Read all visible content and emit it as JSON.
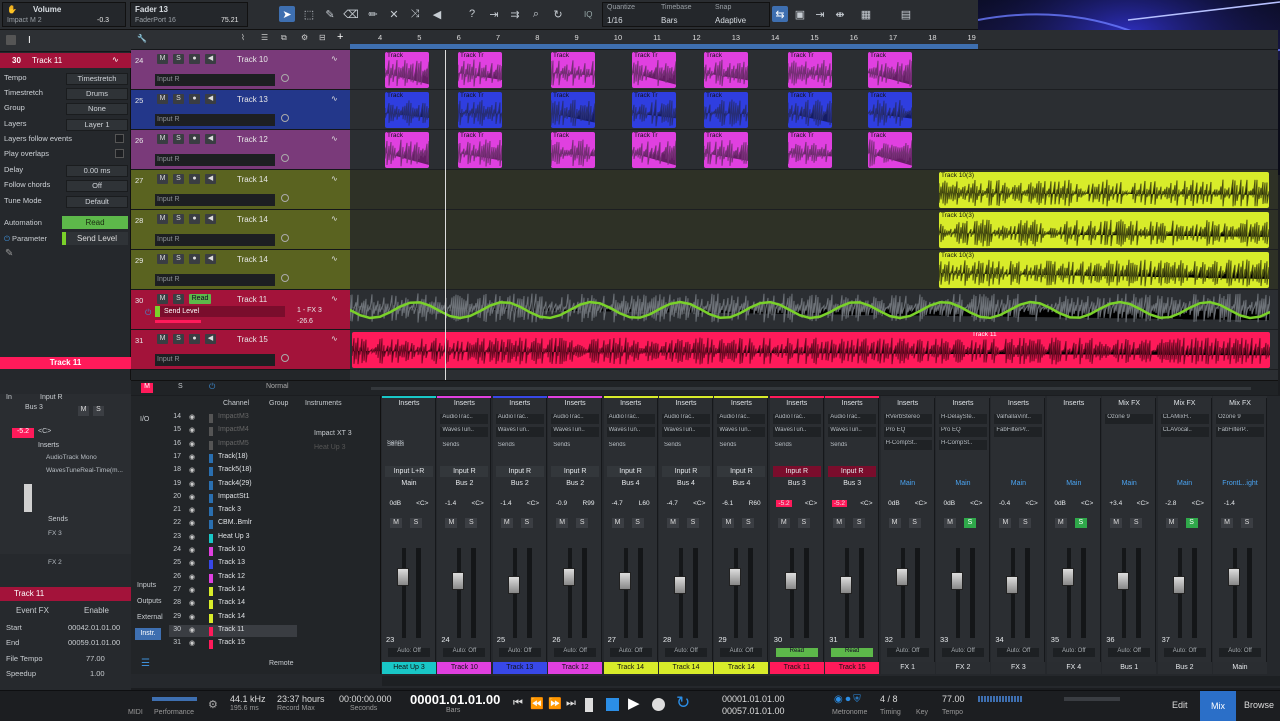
{
  "toolbar": {
    "plugin_title": "Volume",
    "plugin_sub": "Impact M 2",
    "plugin_value": "-0.3",
    "fader_title": "Fader 13",
    "fader_sub": "FaderPort 16",
    "fader_value": "75.21",
    "quantize_label": "Quantize",
    "quantize_value": "1/16",
    "timebase_label": "Timebase",
    "timebase_value": "Bars",
    "snap_label": "Snap",
    "snap_value": "Adaptive",
    "iq_label": "IQ"
  },
  "ruler": [
    "4",
    "5",
    "6",
    "7",
    "8",
    "9",
    "10",
    "11",
    "12",
    "13",
    "14",
    "15",
    "16",
    "17",
    "18",
    "19"
  ],
  "inspector": {
    "track_no": "30",
    "track_name": "Track 11",
    "rows": [
      {
        "label": "Tempo",
        "value": "Timestretch"
      },
      {
        "label": "Timestretch",
        "value": "Drums"
      },
      {
        "label": "Group",
        "value": "None"
      },
      {
        "label": "Layers",
        "value": "Layer 1"
      },
      {
        "label": "Layers follow events",
        "value": ""
      },
      {
        "label": "Play overlaps",
        "value": ""
      },
      {
        "label": "Delay",
        "value": "0.00 ms"
      },
      {
        "label": "Follow chords",
        "value": "Off"
      },
      {
        "label": "Tune Mode",
        "value": "Default"
      }
    ],
    "automation_label": "Automation",
    "automation_value": "Read",
    "parameter_label": "Parameter",
    "parameter_value": "Send Level",
    "track_banner": "Track 11",
    "in_label": "In",
    "in_value": "Input R",
    "bus_label": "Bus 3",
    "vol_value": "-5.2",
    "pan_value": "<C>",
    "inserts_label": "Inserts",
    "insert_1": "AudioTrack Mono",
    "insert_2": "WavesTuneReal-Time(m...",
    "sends_label": "Sends",
    "send_1": "FX 3",
    "send_2": "FX 2",
    "event_track": "Track 11",
    "event_fx": "Event FX",
    "enable": "Enable",
    "start_label": "Start",
    "start_value": "00042.01.01.00",
    "end_label": "End",
    "end_value": "00059.01.01.00",
    "filetempo_label": "File Tempo",
    "filetempo_value": "77.00",
    "speedup_label": "Speedup",
    "speedup_value": "1.00"
  },
  "tracks": [
    {
      "no": "24",
      "name": "Track 10",
      "input": "Input R",
      "color": "#7a3a7a",
      "clip": "#e040e0"
    },
    {
      "no": "25",
      "name": "Track 13",
      "input": "Input R",
      "color": "#23378a",
      "clip": "#2f3ee0"
    },
    {
      "no": "26",
      "name": "Track 12",
      "input": "Input R",
      "color": "#7a3a7a",
      "clip": "#e040e0"
    },
    {
      "no": "27",
      "name": "Track 14",
      "input": "Input R",
      "color": "#5a6320",
      "clip": "#d8ec2a"
    },
    {
      "no": "28",
      "name": "Track 14",
      "input": "Input R",
      "color": "#5a6320",
      "clip": "#d8ec2a"
    },
    {
      "no": "29",
      "name": "Track 14",
      "input": "Input R",
      "color": "#5a6320",
      "clip": "#d8ec2a"
    },
    {
      "no": "30",
      "name": "Track 11",
      "input": "Send Level",
      "color": "#a3133a",
      "clip": "#ff1a5a"
    },
    {
      "no": "31",
      "name": "Track 15",
      "input": "Input R",
      "color": "#a3133a",
      "clip": "#ff1a5a"
    }
  ],
  "track30": {
    "read": "Read",
    "send_dest": "1 - FX 3",
    "send_val": "-26.6"
  },
  "clip_labels": {
    "track": "Track",
    "track_tr": "Track Tr",
    "yellow": "Track 10(3)",
    "track11": "Track 11"
  },
  "arrfoot": {
    "m": "M",
    "s": "S",
    "mode": "Normal"
  },
  "console_nav": {
    "channel": "Channel",
    "group": "Group",
    "instruments": "Instruments",
    "inst_1": "Impact XT 2",
    "inst_2": "Impact XT 3",
    "inst_3": "Heat Up 3",
    "io": "I/O",
    "inputs": "Inputs",
    "outputs": "Outputs",
    "external": "External",
    "instr": "Instr.",
    "remote": "Remote"
  },
  "channel_list": [
    {
      "no": "14",
      "name": "ImpactM3"
    },
    {
      "no": "15",
      "name": "ImpactM4"
    },
    {
      "no": "16",
      "name": "ImpactM5"
    },
    {
      "no": "17",
      "name": "Track(18)"
    },
    {
      "no": "18",
      "name": "Track5(18)"
    },
    {
      "no": "19",
      "name": "Track4(29)"
    },
    {
      "no": "20",
      "name": "ImpactSt1"
    },
    {
      "no": "21",
      "name": "Track 3"
    },
    {
      "no": "22",
      "name": "CBM..Bmlr"
    },
    {
      "no": "23",
      "name": "Heat Up 3"
    },
    {
      "no": "24",
      "name": "Track 10"
    },
    {
      "no": "25",
      "name": "Track 13"
    },
    {
      "no": "26",
      "name": "Track 12"
    },
    {
      "no": "27",
      "name": "Track 14"
    },
    {
      "no": "28",
      "name": "Track 14"
    },
    {
      "no": "29",
      "name": "Track 14"
    },
    {
      "no": "30",
      "name": "Track 11"
    },
    {
      "no": "31",
      "name": "Track 15"
    }
  ],
  "strips": [
    {
      "no": "23",
      "tag": "Heat Up 3",
      "tagc": "#19c7c7",
      "io1": "Input L+R",
      "io2": "Main",
      "vol": "0dB",
      "pan": "<C>",
      "i1": "",
      "i2": "",
      "read": false,
      "sends": "Sends"
    },
    {
      "no": "24",
      "tag": "Track 10",
      "tagc": "#e040e0",
      "io1": "Input R",
      "io2": "Bus 2",
      "vol": "-1.4",
      "pan": "<C>",
      "i1": "AudioTrac..",
      "i2": "WavesTun..",
      "read": false
    },
    {
      "no": "25",
      "tag": "Track 13",
      "tagc": "#3848e8",
      "io1": "Input R",
      "io2": "Bus 2",
      "vol": "-1.4",
      "pan": "<C>",
      "i1": "AudioTrac..",
      "i2": "WavesTun..",
      "read": false
    },
    {
      "no": "26",
      "tag": "Track 12",
      "tagc": "#e040e0",
      "io1": "Input R",
      "io2": "Bus 2",
      "vol": "-0.9",
      "pan": "R99",
      "i1": "AudioTrac..",
      "i2": "WavesTun..",
      "read": false
    },
    {
      "no": "27",
      "tag": "Track 14",
      "tagc": "#d8ec2a",
      "io1": "Input R",
      "io2": "Bus 4",
      "vol": "-4.7",
      "pan": "L60",
      "i1": "AudioTrac..",
      "i2": "WavesTun..",
      "read": false
    },
    {
      "no": "28",
      "tag": "Track 14",
      "tagc": "#d8ec2a",
      "io1": "Input R",
      "io2": "Bus 4",
      "vol": "-4.7",
      "pan": "<C>",
      "i1": "AudioTrac..",
      "i2": "WavesTun..",
      "read": false
    },
    {
      "no": "29",
      "tag": "Track 14",
      "tagc": "#d8ec2a",
      "io1": "Input R",
      "io2": "Bus 4",
      "vol": "-6.1",
      "pan": "R60",
      "i1": "AudioTrac..",
      "i2": "WavesTun..",
      "read": false
    },
    {
      "no": "30",
      "tag": "Track 11",
      "tagc": "#ff1a5a",
      "io1": "Input R",
      "io2": "Bus 3",
      "vol": "-5.2",
      "pan": "<C>",
      "i1": "AudioTrac..",
      "i2": "WavesTun..",
      "read": true
    },
    {
      "no": "31",
      "tag": "Track 15",
      "tagc": "#ff1a5a",
      "io1": "Input R",
      "io2": "Bus 3",
      "vol": "-5.2",
      "pan": "<C>",
      "i1": "AudioTrac..",
      "i2": "WavesTun..",
      "read": true
    },
    {
      "no": "32",
      "tag": "FX 1",
      "tagc": "#2a2d31",
      "io1": "",
      "io2": "Main",
      "vol": "0dB",
      "pan": "<C>",
      "i1": "RVerbStereo",
      "i2": "Pro EQ",
      "i3": "H-CompSt..",
      "read": false,
      "fx": true
    },
    {
      "no": "33",
      "tag": "FX 2",
      "tagc": "#2a2d31",
      "io1": "",
      "io2": "Main",
      "vol": "0dB",
      "pan": "<C>",
      "i1": "H-DelaySte..",
      "i2": "Pro EQ",
      "i3": "H-CompSt..",
      "read": false,
      "fx": true
    },
    {
      "no": "34",
      "tag": "FX 3",
      "tagc": "#2a2d31",
      "io1": "",
      "io2": "Main",
      "vol": "-0.4",
      "pan": "<C>",
      "i1": "ValhallaVint..",
      "i2": "FabFilterPr..",
      "read": false,
      "fx": true
    },
    {
      "no": "35",
      "tag": "FX 4",
      "tagc": "#2a2d31",
      "io1": "",
      "io2": "Main",
      "vol": "0dB",
      "pan": "<C>",
      "i1": "",
      "i2": "",
      "read": false,
      "fx": true
    },
    {
      "no": "36",
      "tag": "Bus 1",
      "tagc": "#2a2d31",
      "io1": "",
      "io2": "Main",
      "vol": "+3.4",
      "pan": "<C>",
      "i1": "Ozone 9",
      "i2": "",
      "read": false,
      "fx": true,
      "mixfx": "Mix FX"
    },
    {
      "no": "37",
      "tag": "Bus 2",
      "tagc": "#2a2d31",
      "io1": "",
      "io2": "Main",
      "vol": "-2.8",
      "pan": "<C>",
      "i1": "CLAMixH..",
      "i2": "CLAVocal..",
      "read": false,
      "fx": true,
      "mixfx": "Mix FX"
    },
    {
      "no": "",
      "tag": "Main",
      "tagc": "#2a2d31",
      "io1": "",
      "io2": "FrontL..ight",
      "vol": "-1.4",
      "pan": "",
      "i1": "Ozone 9",
      "i2": "FabFilterP..",
      "read": false,
      "fx": true,
      "mixfx": "Mix FX"
    }
  ],
  "strip_labels": {
    "inserts": "Inserts",
    "auto": "Auto: Off",
    "read": "Read",
    "m": "M",
    "s": "S",
    "sends": "Sends"
  },
  "transport": {
    "midi": "MIDI",
    "performance": "Performance",
    "rate": "44.1 kHz",
    "rate_sub": "195.6 ms",
    "hours": "23:37 hours",
    "hours_sub": "Record Max",
    "seconds": "00:00:00.000",
    "seconds_sub": "Seconds",
    "bars": "00001.01.01.00",
    "bars_sub": "Bars",
    "loop_l": "00001.01.01.00",
    "loop_r": "00057.01.01.00",
    "metronome": "Metronome",
    "timing": "Timing",
    "timesig": "4 / 8",
    "key": "Key",
    "tempo": "77.00",
    "tempo_label": "Tempo",
    "edit": "Edit",
    "mix": "Mix",
    "browse": "Browse"
  },
  "colors": {
    "accent": "#3e6fb0",
    "magenta": "#e040e0",
    "blue": "#2f3ee0",
    "yellow": "#d8ec2a",
    "red": "#ff1a5a",
    "cyan": "#19c7c7",
    "automation": "#7ad12a"
  }
}
